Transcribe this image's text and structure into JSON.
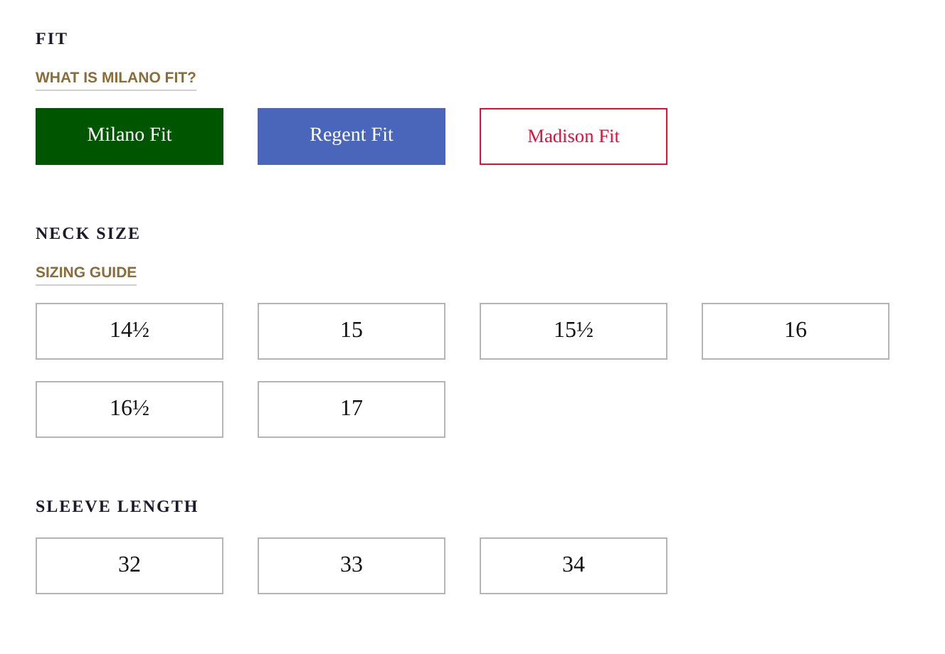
{
  "fit": {
    "heading": "FIT",
    "guide_link": "WHAT IS MILANO FIT?",
    "options": [
      {
        "label": "Milano Fit",
        "kind": "filled",
        "color": "#005500"
      },
      {
        "label": "Regent Fit",
        "kind": "filled",
        "color": "#4a66bb"
      },
      {
        "label": "Madison Fit",
        "kind": "outline",
        "color": "#e0103a"
      }
    ]
  },
  "neck_size": {
    "heading": "NECK SIZE",
    "guide_link": "SIZING GUIDE",
    "options": [
      "14½",
      "15",
      "15½",
      "16",
      "16½",
      "17"
    ]
  },
  "sleeve_length": {
    "heading": "SLEEVE LENGTH",
    "options": [
      "32",
      "33",
      "34"
    ]
  }
}
